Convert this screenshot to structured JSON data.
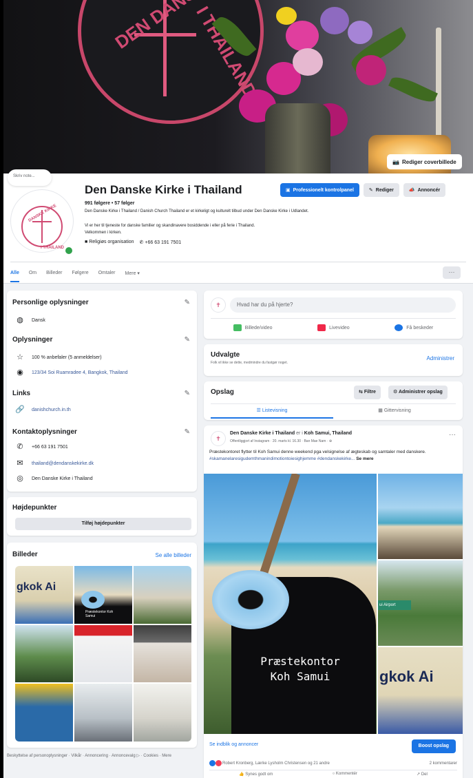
{
  "cover": {
    "edit_button": "Rediger coverbillede",
    "logo_text_1": "DEN DANSKE",
    "logo_text_2": "I THAILAND"
  },
  "profile": {
    "status_bubble": "Skriv note...",
    "name": "Den Danske Kirke i Thailand",
    "stats": "991 følgere • 57 følger",
    "description": "Den Danske Kirke i Thailand / Danish Church Thailand er et kirkeligt og kulturelt tilbud under Den Danske Kirke i Udlandet.",
    "description_2a": "Vi er her til tjeneste for danske familier og skandinavere bosiddende i eller på ferie i Thailand.",
    "description_2b": "Velkommen i kirken.",
    "category": "Religiøs organisation",
    "phone": "+66 63 191 7501",
    "avatar_text_1": "DANSKE KIRKE",
    "avatar_text_2": "I THAILAND"
  },
  "header_buttons": {
    "pro": "Professionelt kontrolpanel",
    "edit": "Rediger",
    "ads": "Annoncér"
  },
  "tabs": [
    "Alle",
    "Om",
    "Billeder",
    "Følgere",
    "Omtaler",
    "Mere ▾"
  ],
  "more_dots": "···",
  "intro": {
    "personal_title": "Personlige oplysninger",
    "language": "Dansk",
    "info_title": "Oplysninger",
    "recommend": "100 % anbefaler (5 anmeldelser)",
    "address": "123/34 Soi Ruamradee 4, Bangkok, Thailand",
    "links_title": "Links",
    "website": "danishchurch.in.th",
    "contact_title": "Kontaktoplysninger",
    "contact_phone": "+66 63 191 7501",
    "email": "thailand@dendanskekirke.dk",
    "messenger": "Den Danske Kirke i Thailand"
  },
  "highlights": {
    "title": "Højdepunkter",
    "button": "Tilføj højdepunkter"
  },
  "photos": {
    "title": "Billeder",
    "see_all": "Se alle billeder",
    "labels": [
      "gkok Ai",
      "Præstekontor Koh Samui"
    ]
  },
  "footer": "Beskyttelse af personoplysninger · Vilkår · Annoncering · Annoncevalg ▷ · Cookies · Mere",
  "composer": {
    "placeholder": "Hvad har du på hjerte?",
    "photo": "Billede/video",
    "live": "Livevideo",
    "messages": "Få beskeder"
  },
  "featured": {
    "title": "Udvalgte",
    "subtitle": "Folk vil ikke se dette, medmindre du fastgør noget.",
    "admin": "Administrer"
  },
  "posts": {
    "title": "Opslag",
    "filter": "Filtre",
    "manage": "Administrer opslag",
    "list_view": "☰ Listevisning",
    "grid_view": "▦ Gittervisning"
  },
  "post": {
    "author": "Den Danske Kirke i Thailand",
    "is_in": "er i",
    "place": "Koh Samui, Thailand",
    "meta": "Offentliggjort af Instagram · 20. marts kl. 16.30 · Ban Mae Nam · ⊕",
    "text": "Præstekontoret flytter til Koh Samui denne weekend pga velsignelse af ægteskab og samtaler med danskere.",
    "tags": "#skamanelaresigudemthmanindimotiontoiesighjemme #dendanskekirke...",
    "see_more": "Se mere",
    "caption_1": "Præstekontor",
    "caption_2": "Koh Samui",
    "insights": "Se indblik og annoncer",
    "boost": "Boost opslag",
    "reactions": "Robert Kronberg, Lærke Lysholm Christensen og 21 andre",
    "comments": "2 kommentarer",
    "like": "Synes godt om",
    "comment": "Kommentér",
    "share": "Del",
    "airplane_text": "gkok Ai"
  }
}
